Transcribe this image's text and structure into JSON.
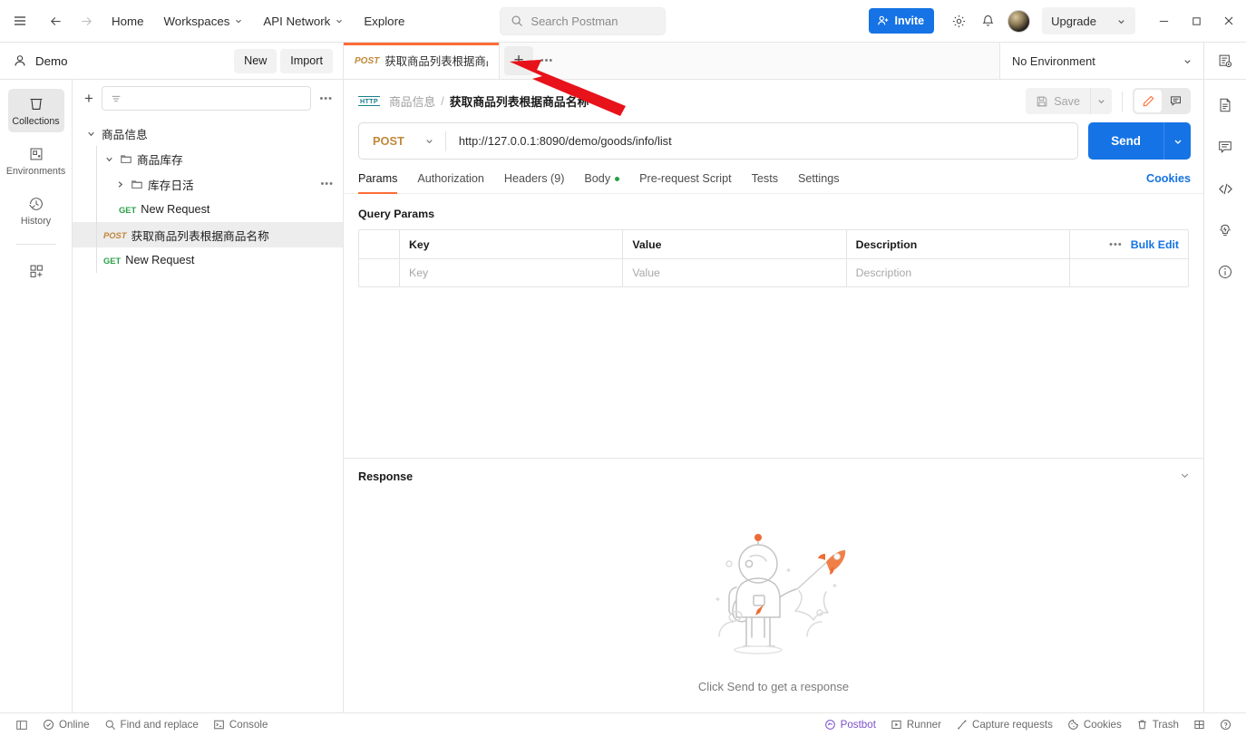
{
  "header": {
    "nav": [
      {
        "label": "Home",
        "caret": false
      },
      {
        "label": "Workspaces",
        "caret": true
      },
      {
        "label": "API Network",
        "caret": true
      },
      {
        "label": "Explore",
        "caret": false
      }
    ],
    "search_placeholder": "Search Postman",
    "invite_label": "Invite",
    "upgrade_label": "Upgrade",
    "icons": {
      "hamburger": "hamburger-icon",
      "back": "back-arrow-icon",
      "forward": "forward-arrow-icon",
      "search": "search-icon",
      "invite": "user-plus-icon",
      "settings": "gear-icon",
      "notifications": "bell-icon",
      "avatar": "avatar",
      "minimize": "minimize-icon",
      "maximize": "maximize-icon",
      "close": "close-icon"
    }
  },
  "workspace": {
    "name": "Demo",
    "new_label": "New",
    "import_label": "Import",
    "environment_selected": "No Environment"
  },
  "tabs": [
    {
      "method": "POST",
      "title": "获取商品列表根据商品名称",
      "active": true
    }
  ],
  "sidebar": {
    "filter_placeholder": "",
    "rail": [
      {
        "label": "Collections",
        "icon": "collections-icon",
        "active": true
      },
      {
        "label": "Environments",
        "icon": "environments-icon",
        "active": false
      },
      {
        "label": "History",
        "icon": "history-icon",
        "active": false
      }
    ],
    "rail_bottom_icon": "add-apps-icon",
    "tree": [
      {
        "label": "商品信息",
        "type": "collection",
        "depth": 0,
        "expanded": true,
        "method": "",
        "selected": false
      },
      {
        "label": "商品库存",
        "type": "folder",
        "depth": 1,
        "expanded": true,
        "method": "",
        "selected": false
      },
      {
        "label": "库存日活",
        "type": "folder",
        "depth": 2,
        "expanded": false,
        "method": "",
        "selected": false,
        "dots": true
      },
      {
        "label": "New Request",
        "type": "request",
        "depth": 2,
        "expanded": null,
        "method": "GET",
        "selected": false
      },
      {
        "label": "获取商品列表根据商品名称",
        "type": "request",
        "depth": 1,
        "expanded": null,
        "method": "POST",
        "selected": true
      },
      {
        "label": "New Request",
        "type": "request",
        "depth": 1,
        "expanded": null,
        "method": "GET",
        "selected": false
      }
    ]
  },
  "request": {
    "breadcrumb_protocol": "HTTP",
    "breadcrumb_collection": "商品信息",
    "breadcrumb_separator": "/",
    "breadcrumb_name": "获取商品列表根据商品名称",
    "save_label": "Save",
    "method": "POST",
    "url": "http://127.0.0.1:8090/demo/goods/info/list",
    "send_label": "Send",
    "tabs": [
      {
        "label": "Params",
        "active": true,
        "badge": "",
        "dot": false
      },
      {
        "label": "Authorization",
        "active": false,
        "badge": "",
        "dot": false
      },
      {
        "label": "Headers (9)",
        "active": false,
        "badge": "",
        "dot": false
      },
      {
        "label": "Body",
        "active": false,
        "badge": "",
        "dot": true
      },
      {
        "label": "Pre-request Script",
        "active": false,
        "badge": "",
        "dot": false
      },
      {
        "label": "Tests",
        "active": false,
        "badge": "",
        "dot": false
      },
      {
        "label": "Settings",
        "active": false,
        "badge": "",
        "dot": false
      }
    ],
    "cookies_label": "Cookies",
    "query_params_title": "Query Params",
    "table": {
      "headers": [
        "Key",
        "Value",
        "Description"
      ],
      "bulk_edit_label": "Bulk Edit",
      "rows": [
        {
          "key": "Key",
          "value": "Value",
          "description": "Description",
          "empty": true
        }
      ]
    }
  },
  "response": {
    "label": "Response",
    "empty_message": "Click Send to get a response"
  },
  "right_rail": [
    {
      "icon": "environment-quick-look-icon"
    },
    {
      "icon": "documentation-icon"
    },
    {
      "icon": "comments-icon"
    },
    {
      "icon": "code-icon"
    },
    {
      "icon": "postbot-lightbulb-icon"
    },
    {
      "icon": "info-icon"
    }
  ],
  "statusbar": {
    "left": [
      {
        "label": "",
        "icon": "sidebar-toggle-icon"
      },
      {
        "label": "Online",
        "icon": "online-check-icon"
      },
      {
        "label": "Find and replace",
        "icon": "search-icon"
      },
      {
        "label": "Console",
        "icon": "console-icon"
      }
    ],
    "right": [
      {
        "label": "Postbot",
        "icon": "postbot-icon"
      },
      {
        "label": "Runner",
        "icon": "runner-icon"
      },
      {
        "label": "Capture requests",
        "icon": "capture-icon"
      },
      {
        "label": "Cookies",
        "icon": "cookie-icon"
      },
      {
        "label": "Trash",
        "icon": "trash-icon"
      },
      {
        "label": "",
        "icon": "layout-icon"
      },
      {
        "label": "",
        "icon": "help-icon"
      }
    ]
  },
  "colors": {
    "accent_orange": "#FF6C37",
    "primary_blue": "#1573E5",
    "get_green": "#2A9F47",
    "post_orange": "#C1883A",
    "postbot_purple": "#7B52C9",
    "annotation_red": "#E8121A"
  }
}
